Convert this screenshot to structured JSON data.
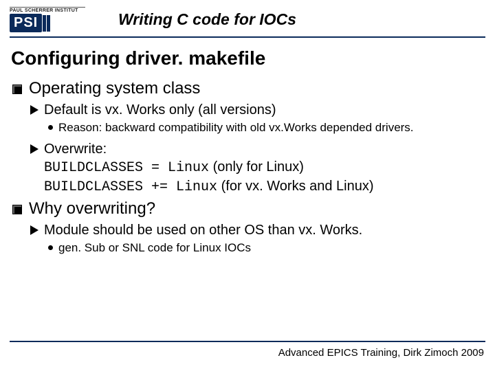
{
  "logo": {
    "overline": "PAUL SCHERRER INSTITUT",
    "mark": "PSI"
  },
  "page_title": "Writing C code for IOCs",
  "heading": "Configuring driver. makefile",
  "sec1": {
    "title": "Operating system class",
    "b1": "Default is vx. Works only (all versions)",
    "b1_sub": "Reason: backward compatibility with old vx.Works depended drivers.",
    "b2_lead": "Overwrite:",
    "b2_code1a": "BUILDCLASSES = Linux",
    "b2_code1b": "  (only for Linux)",
    "b2_code2a": "BUILDCLASSES += Linux",
    "b2_code2b": " (for vx. Works and Linux)"
  },
  "sec2": {
    "title": "Why overwriting?",
    "b1": "Module should be used on other OS than vx. Works.",
    "b1_sub": "gen. Sub or SNL code for Linux IOCs"
  },
  "footer": "Advanced EPICS Training, Dirk Zimoch 2009"
}
